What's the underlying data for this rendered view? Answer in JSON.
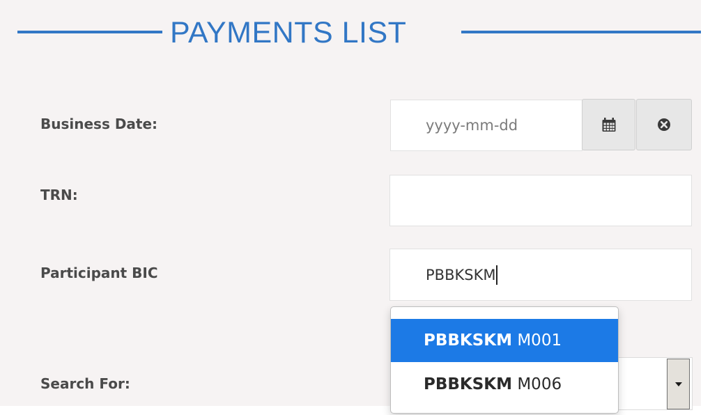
{
  "title": "PAYMENTS LIST",
  "colors": {
    "accent": "#3277c5",
    "panel_bg": "#f6f3f3",
    "highlight": "#1c7ae6"
  },
  "form": {
    "business_date": {
      "label": "Business Date:",
      "placeholder": "yyyy-mm-dd",
      "calendar_icon": "calendar-icon",
      "clear_icon": "circle-x-icon"
    },
    "trn": {
      "label": "TRN:",
      "value": ""
    },
    "participant_bic": {
      "label": "Participant BIC",
      "value": "PBBKSKM"
    },
    "search_for": {
      "label": "Search For:",
      "dropdown_icon": "caret-down-icon"
    }
  },
  "autocomplete": {
    "items": [
      {
        "match": "PBBKSKM",
        "rest": " M001",
        "selected": true
      },
      {
        "match": "PBBKSKM",
        "rest": " M006",
        "selected": false
      }
    ]
  }
}
